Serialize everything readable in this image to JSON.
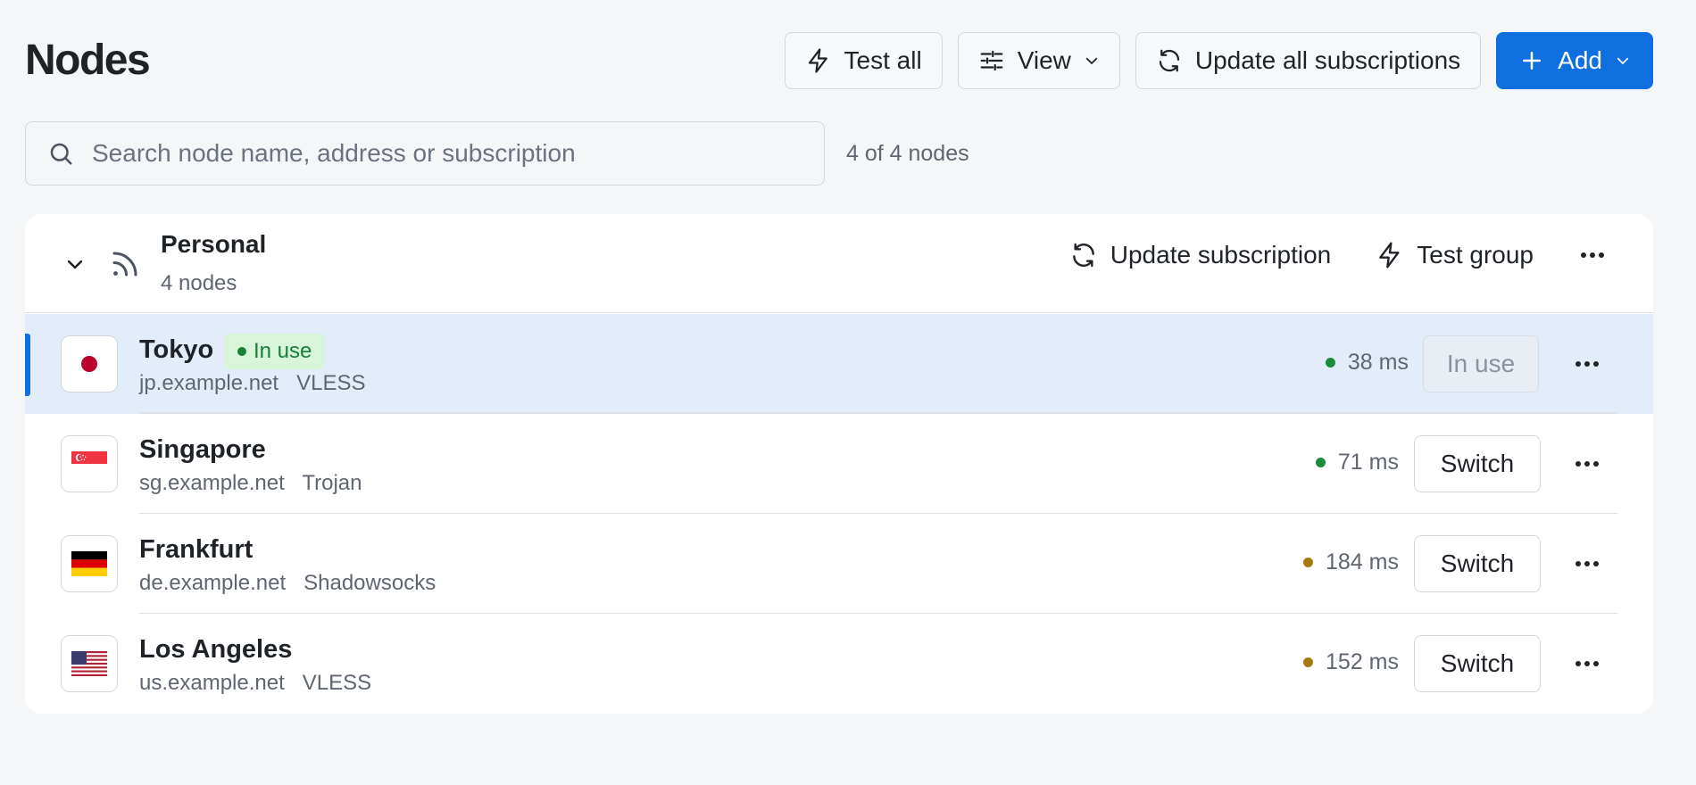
{
  "header": {
    "title": "Nodes",
    "test_all": "Test all",
    "view": "View",
    "update_all": "Update all subscriptions",
    "add": "Add"
  },
  "search": {
    "placeholder": "Search node name, address or subscription",
    "value": "",
    "count": "4 of 4 nodes"
  },
  "group": {
    "name": "Personal",
    "subtitle": "4 nodes",
    "update_label": "Update subscription",
    "test_label": "Test group",
    "nodes": [
      {
        "name": "Tokyo",
        "meta": "jp.example.net   VLESS",
        "badge": "In use",
        "latency": "38 ms",
        "latency_status": "good",
        "action": "In use",
        "flag_icon": "japan-flag-icon"
      },
      {
        "name": "Singapore",
        "meta": "sg.example.net   Trojan",
        "latency": "71 ms",
        "latency_status": "good",
        "action": "Switch",
        "flag_icon": "singapore-flag-icon"
      },
      {
        "name": "Frankfurt",
        "meta": "de.example.net   Shadowsocks",
        "latency": "184 ms",
        "latency_status": "medium",
        "action": "Switch",
        "flag_icon": "germany-flag-icon"
      },
      {
        "name": "Los Angeles",
        "meta": "us.example.net   VLESS",
        "latency": "152 ms",
        "latency_status": "medium",
        "action": "Switch",
        "flag_icon": "usa-flag-icon"
      }
    ]
  },
  "colors": {
    "accent": "#0f6fde",
    "latency_good": "#1a8a3c",
    "latency_medium": "#a57a0e",
    "badge_bg": "#d7f5d9",
    "active_row_bg": "#e3edf9"
  }
}
